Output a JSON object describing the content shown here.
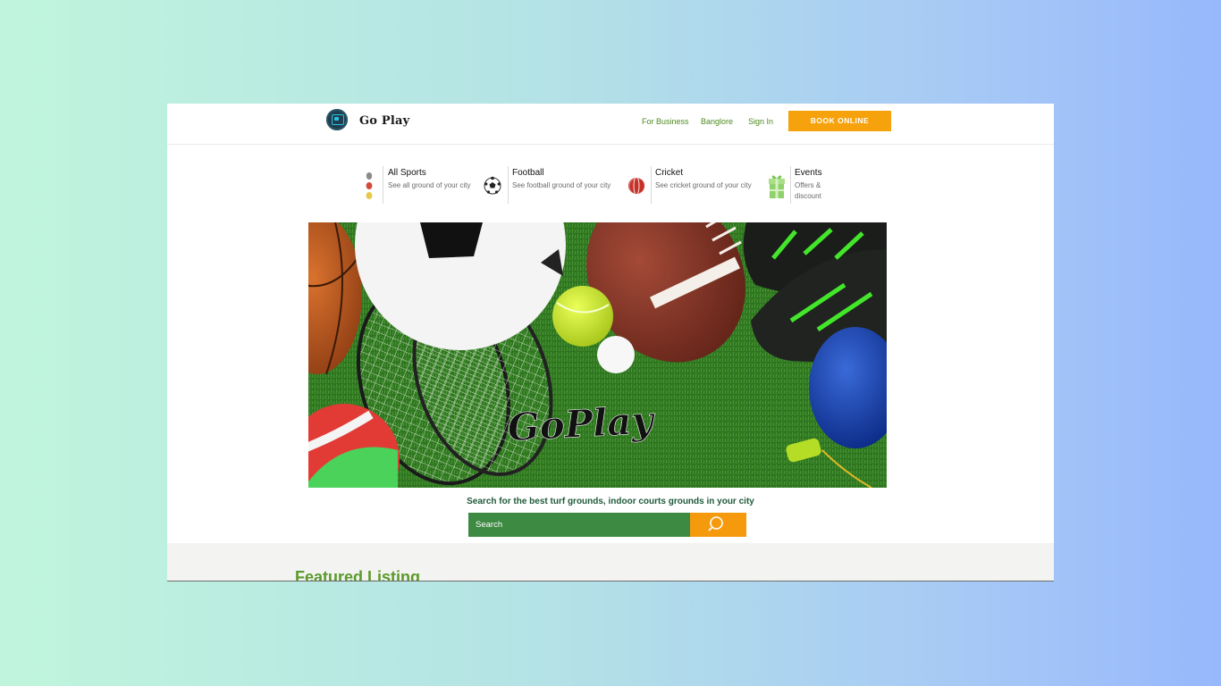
{
  "header": {
    "brand": "Go Play",
    "nav": [
      "For Business",
      "Banglore",
      "Sign In"
    ],
    "book_label": "BOOK ONLINE"
  },
  "categories": [
    {
      "title": "All Sports",
      "desc": "See all ground of your city",
      "icon": "traffic-dots-icon"
    },
    {
      "title": "Football",
      "desc": "See football ground of your city",
      "icon": "football-icon"
    },
    {
      "title": "Cricket",
      "desc": "See cricket ground of your city",
      "icon": "cricket-ball-icon"
    },
    {
      "title": "Events",
      "desc": "Offers & discount",
      "icon": "gift-icon"
    }
  ],
  "hero": {
    "logo_text": "GoPlay"
  },
  "search": {
    "caption": "Search for the best turf grounds, indoor courts grounds in your city",
    "placeholder": "Search"
  },
  "featured": {
    "title": "Featured Listing"
  },
  "colors": {
    "accent_orange": "#f5a20d",
    "link_green": "#4d8a1f",
    "search_green": "#3d8a42"
  }
}
